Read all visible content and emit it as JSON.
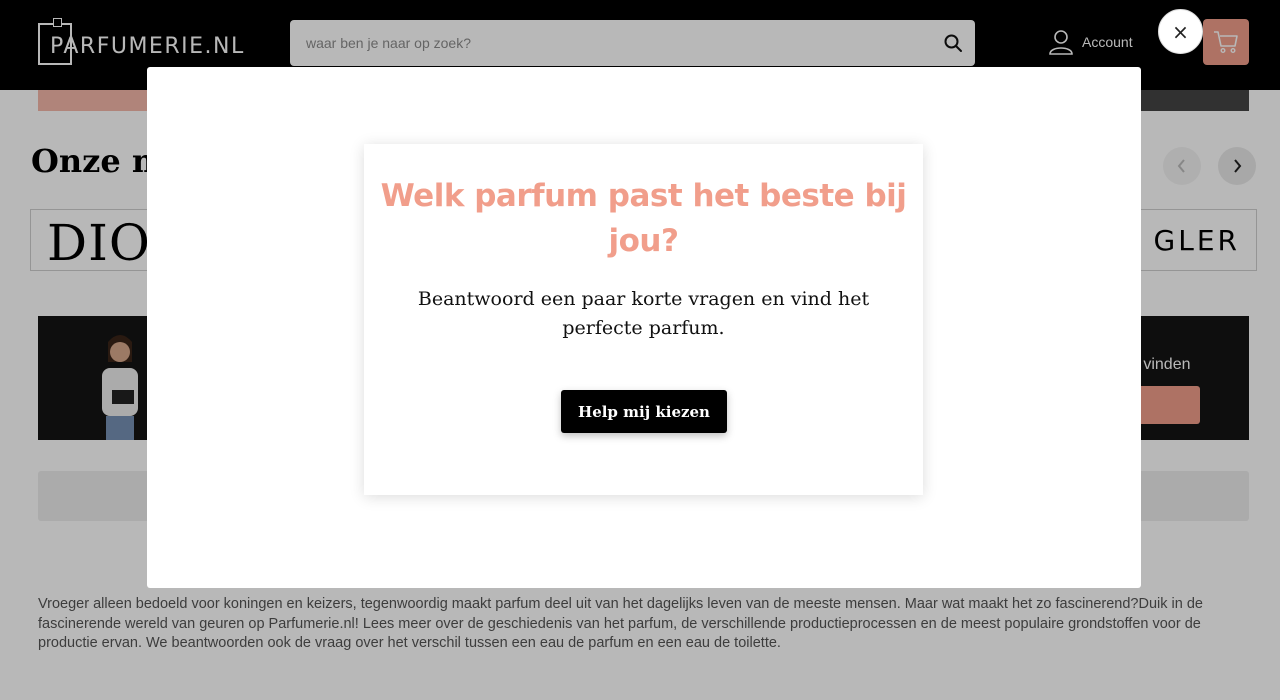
{
  "header": {
    "logo_text": "PARFUMERIE.NL",
    "search": {
      "placeholder": "waar ben je naar op zoek?"
    },
    "account_label": "Account",
    "icons": [
      "search-icon",
      "user-icon",
      "cart-icon"
    ]
  },
  "page": {
    "brands_title": "Onze m",
    "brands": [
      "DIO",
      "GLER"
    ],
    "banner_text": "u vinden",
    "intro": "Vroeger alleen bedoeld voor koningen en keizers, tegenwoordig maakt parfum deel uit van het dagelijks leven van de meeste mensen. Maar wat maakt het zo fascinerend?Duik in de fascinerende wereld van geuren op Parfumerie.nl! Lees meer over de geschiedenis van het parfum, de verschillende productieprocessen en de meest populaire grondstoffen voor de productie ervan. We beantwoorden ook de vraag over het verschil tussen een eau de parfum en een eau de toilette."
  },
  "modal": {
    "close_label": "×",
    "title": "Welk parfum past het beste bij jou?",
    "subtitle": "Beantwoord een paar korte vragen en vind het perfecte parfum.",
    "cta_label": "Help mij kiezen"
  },
  "colors": {
    "accent": "#f19e8b",
    "header_bg": "#000000",
    "overlay": "rgba(0,0,0,0.28)"
  }
}
